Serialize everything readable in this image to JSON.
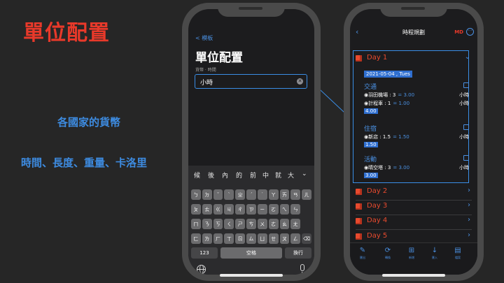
{
  "slide": {
    "title": "單位配置",
    "note1": "各國家的貨幣",
    "note2": "時間、長度、重量、卡洛里"
  },
  "left_phone": {
    "back_label": "< 模板",
    "title": "單位配置",
    "subtitle": "貨幣 · 時間",
    "input_value": "小時",
    "clear_icon": "clear-icon",
    "suggestions": [
      "候",
      "後",
      "內",
      "的",
      "前",
      "中",
      "就",
      "大"
    ],
    "keyboard_rows": [
      [
        "ㄅ",
        "ㄉ",
        "ˇ",
        "ˋ",
        "ㄓ",
        "ˊ",
        "˙",
        "ㄚ",
        "ㄞ",
        "ㄢ",
        "ㄦ"
      ],
      [
        "ㄆ",
        "ㄊ",
        "ㄍ",
        "ㄐ",
        "ㄔ",
        "ㄗ",
        "ㄧ",
        "ㄛ",
        "ㄟ",
        "ㄣ",
        ""
      ],
      [
        "ㄇ",
        "ㄋ",
        "ㄎ",
        "ㄑ",
        "ㄕ",
        "ㄘ",
        "ㄨ",
        "ㄜ",
        "ㄠ",
        "ㄤ",
        ""
      ],
      [
        "ㄈ",
        "ㄌ",
        "ㄏ",
        "ㄒ",
        "ㄖ",
        "ㄙ",
        "ㄩ",
        "ㄝ",
        "ㄡ",
        "ㄥ",
        "⌫"
      ]
    ],
    "key_123": "123",
    "key_space": "空格",
    "key_return": "換行"
  },
  "right_phone": {
    "title": "時程規劃",
    "md_label": "MD",
    "day1": {
      "label": "Day 1",
      "date": "2021-05-04 , Tues",
      "sections": [
        {
          "title": "交通",
          "items": [
            {
              "name": "◉羽田機場 : 3",
              "eq": "= 3.00",
              "unit": "小時"
            },
            {
              "name": "◉計程車 : 1",
              "eq": "= 1.00",
              "unit": "小時"
            }
          ],
          "total": "4.00"
        },
        {
          "title": "住宿",
          "items": [
            {
              "name": "◉新店 : 1.5",
              "eq": "= 1.50",
              "unit": "小時"
            }
          ],
          "total": "1.50"
        },
        {
          "title": "活動",
          "items": [
            {
              "name": "◉晴空塔 : 3",
              "eq": "= 3.00",
              "unit": "小時"
            }
          ],
          "total": "3.00"
        }
      ]
    },
    "other_days": [
      "Day 2",
      "Day 3",
      "Day 4",
      "Day 5"
    ],
    "tabs": [
      {
        "label": "匯出",
        "icon": "edit-icon"
      },
      {
        "label": "轉換",
        "icon": "sync-icon"
      },
      {
        "label": "新增",
        "icon": "add-icon"
      },
      {
        "label": "匯入",
        "icon": "download-icon"
      },
      {
        "label": "檔案",
        "icon": "file-icon"
      }
    ],
    "colors": {
      "accent": "#3a8ee6",
      "day": "#e84a2e",
      "md": "#e8392a"
    }
  }
}
